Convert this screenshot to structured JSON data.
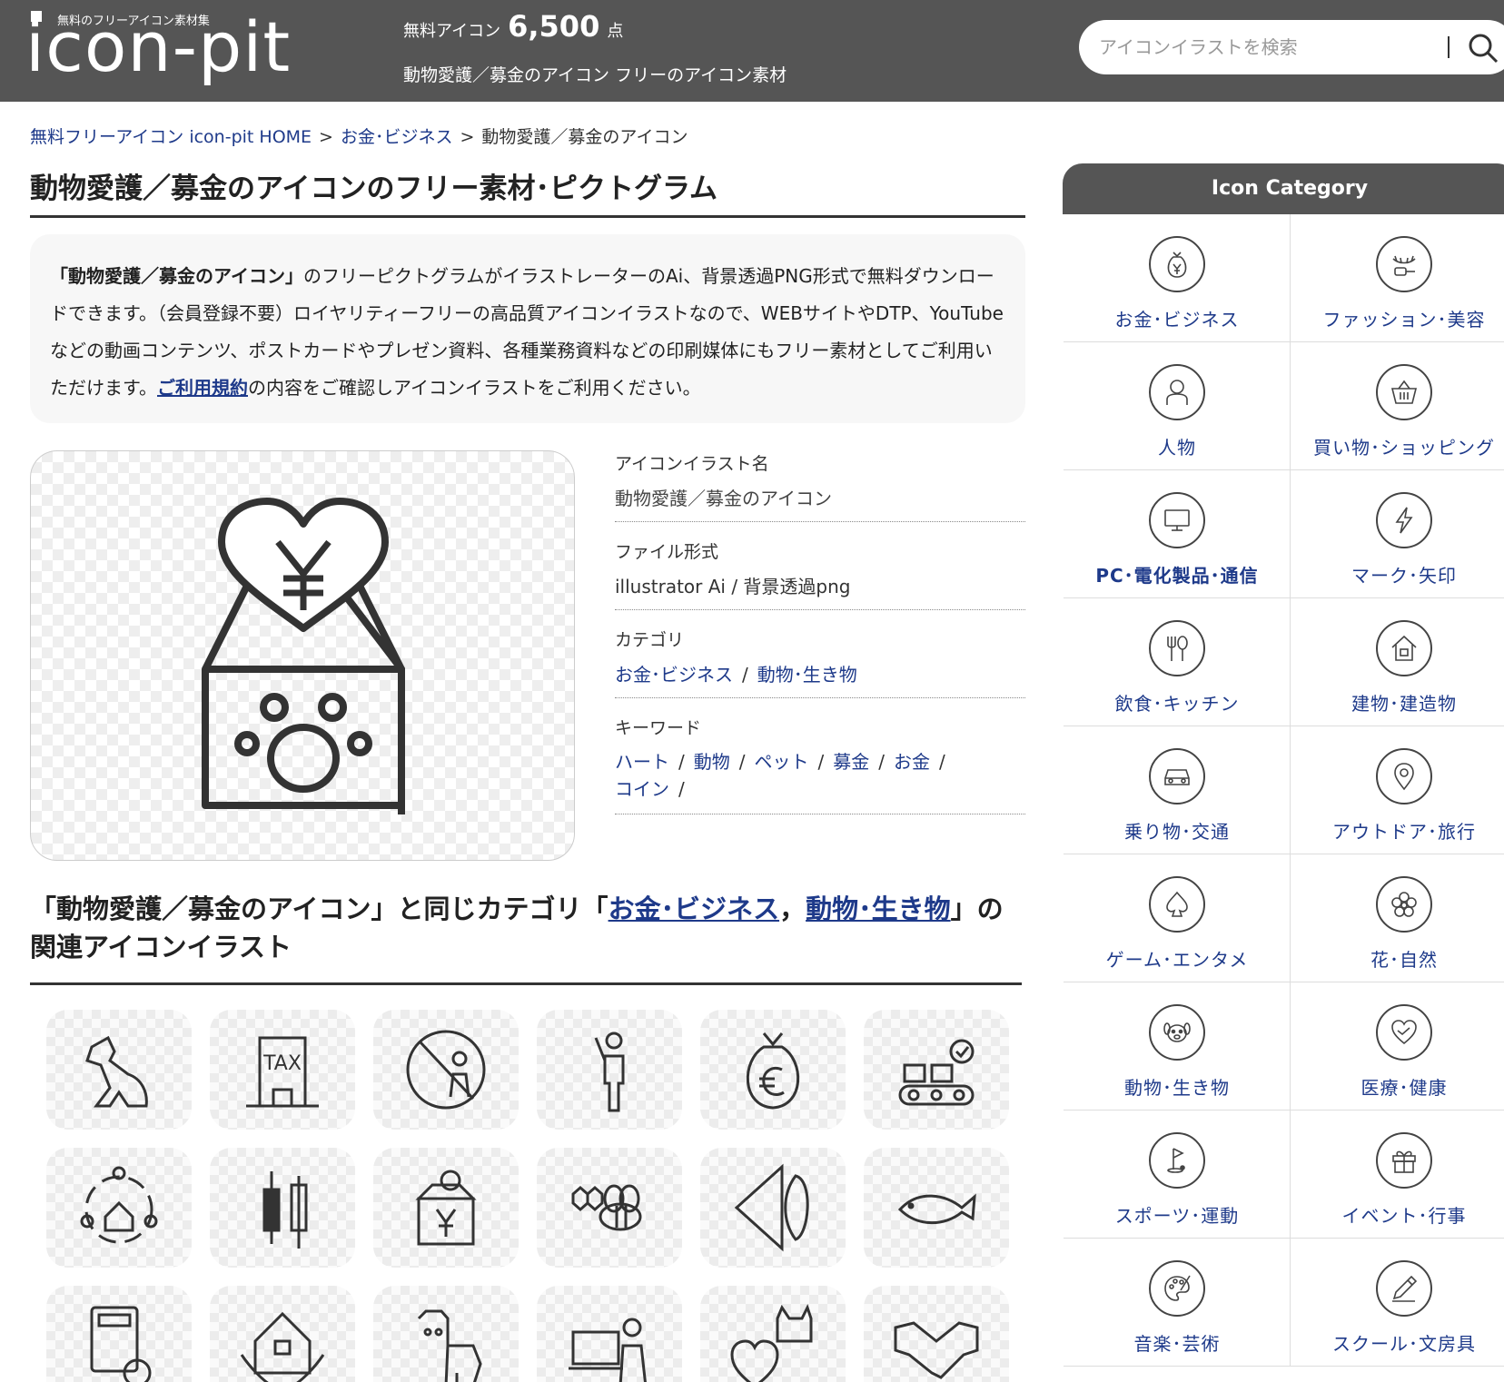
{
  "header": {
    "logo_tagline": "無料のフリーアイコン素材集",
    "logo_text": "icon-pit",
    "count_prefix": "無料アイコン",
    "count_number": "6,500",
    "count_suffix": "点",
    "subtitle": "動物愛護／募金のアイコン フリーのアイコン素材",
    "search_placeholder": "アイコンイラストを検索",
    "search_bar_glyph": "|"
  },
  "breadcrumb": {
    "home": "無料フリーアイコン icon-pit HOME",
    "category": "お金･ビジネス",
    "current": "動物愛護／募金のアイコン",
    "separator": ">"
  },
  "page_title": "動物愛護／募金のアイコンのフリー素材･ピクトグラム",
  "description": {
    "bold_name": "「動物愛護／募金のアイコン」",
    "text_before_link": "のフリーピクトグラムがイラストレーターのAi、背景透過PNG形式で無料ダウンロードできます。（会員登録不要）ロイヤリティーフリーの高品質アイコンイラストなので、WEBサイトやDTP、YouTubeなどの動画コンテンツ、ポストカードやプレゼン資料、各種業務資料などの印刷媒体にもフリー素材としてご利用いただけます。",
    "link_text": "ご利用規約",
    "text_after_link": "の内容をご確認しアイコンイラストをご利用ください。"
  },
  "info": {
    "name_label": "アイコンイラスト名",
    "name_value": "動物愛護／募金のアイコン",
    "format_label": "ファイル形式",
    "format_value": "illustrator Ai / 背景透過png",
    "category_label": "カテゴリ",
    "categories": [
      "お金･ビジネス",
      "動物･生き物"
    ],
    "keyword_label": "キーワード",
    "keywords": [
      "ハート",
      "動物",
      "ペット",
      "募金",
      "お金",
      "コイン"
    ],
    "slash": "/"
  },
  "related": {
    "prefix": "「動物愛護／募金のアイコン」と同じカテゴリ「",
    "cat1": "お金･ビジネス",
    "comma": "，",
    "cat2": "動物･生き物",
    "suffix": "」の関連アイコンイラスト",
    "icons": [
      "dog-icon",
      "tax-office-icon",
      "no-poaching-icon",
      "person-pointing-icon",
      "euro-money-bag-icon",
      "conveyor-boxes-icon",
      "community-house-icon",
      "candlestick-chart-icon",
      "donation-box-yen-icon",
      "bee-honeycomb-icon",
      "angelfish-icon",
      "fish-icon",
      "calculator-dollar-icon",
      "house-hands-icon",
      "horse-icon",
      "online-meeting-icon",
      "cat-medical-icon",
      "handshake-icon"
    ]
  },
  "sidebar": {
    "title": "Icon Category",
    "items": [
      {
        "label": "お金･ビジネス",
        "icon": "money-bag-icon"
      },
      {
        "label": "ファッション･美容",
        "icon": "eyelash-icon"
      },
      {
        "label": "人物",
        "icon": "person-icon"
      },
      {
        "label": "買い物･ショッピング",
        "icon": "basket-icon"
      },
      {
        "label": "PC･電化製品･通信",
        "icon": "monitor-icon"
      },
      {
        "label": "マーク･矢印",
        "icon": "lightning-icon"
      },
      {
        "label": "飲食･キッチン",
        "icon": "fork-spoon-icon"
      },
      {
        "label": "建物･建造物",
        "icon": "house-icon"
      },
      {
        "label": "乗り物･交通",
        "icon": "car-icon"
      },
      {
        "label": "アウトドア･旅行",
        "icon": "map-pin-icon"
      },
      {
        "label": "ゲーム･エンタメ",
        "icon": "spade-icon"
      },
      {
        "label": "花･自然",
        "icon": "flower-icon"
      },
      {
        "label": "動物･生き物",
        "icon": "dog-face-icon"
      },
      {
        "label": "医療･健康",
        "icon": "heart-hands-icon"
      },
      {
        "label": "スポーツ･運動",
        "icon": "golf-flag-icon"
      },
      {
        "label": "イベント･行事",
        "icon": "gift-icon"
      },
      {
        "label": "音楽･芸術",
        "icon": "palette-icon"
      },
      {
        "label": "スクール･文房具",
        "icon": "pen-icon"
      }
    ]
  }
}
